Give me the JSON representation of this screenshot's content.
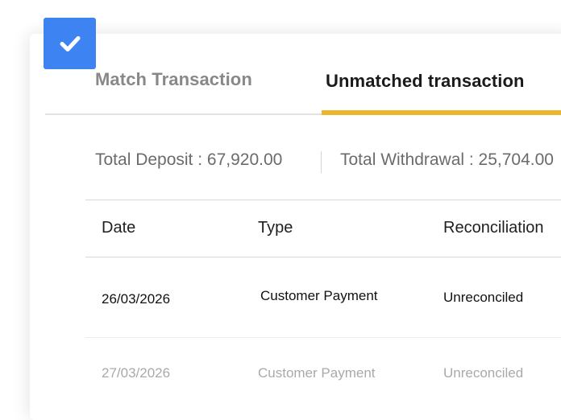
{
  "tabs": [
    {
      "label": "Match Transaction",
      "active": false
    },
    {
      "label": "Unmatched transaction",
      "active": true
    }
  ],
  "totals": {
    "deposit": "Total Deposit : 67,920.00",
    "withdrawal": "Total Withdrawal : 25,704.00"
  },
  "table": {
    "columns": [
      "Date",
      "Type",
      "Reconciliation"
    ],
    "rows": [
      {
        "date": "26/03/2026",
        "type": "Customer Payment",
        "status": "Unreconciled"
      },
      {
        "date": "27/03/2026",
        "type": "Customer Payment",
        "status": "Unreconciled"
      }
    ]
  },
  "icons": {
    "badge": "checkmark-icon"
  },
  "colors": {
    "badge_bg": "#3d84f2",
    "tab_indicator": "#ecb52f",
    "active_tab_text": "#1a1a1a",
    "inactive_tab_text": "#888888"
  }
}
